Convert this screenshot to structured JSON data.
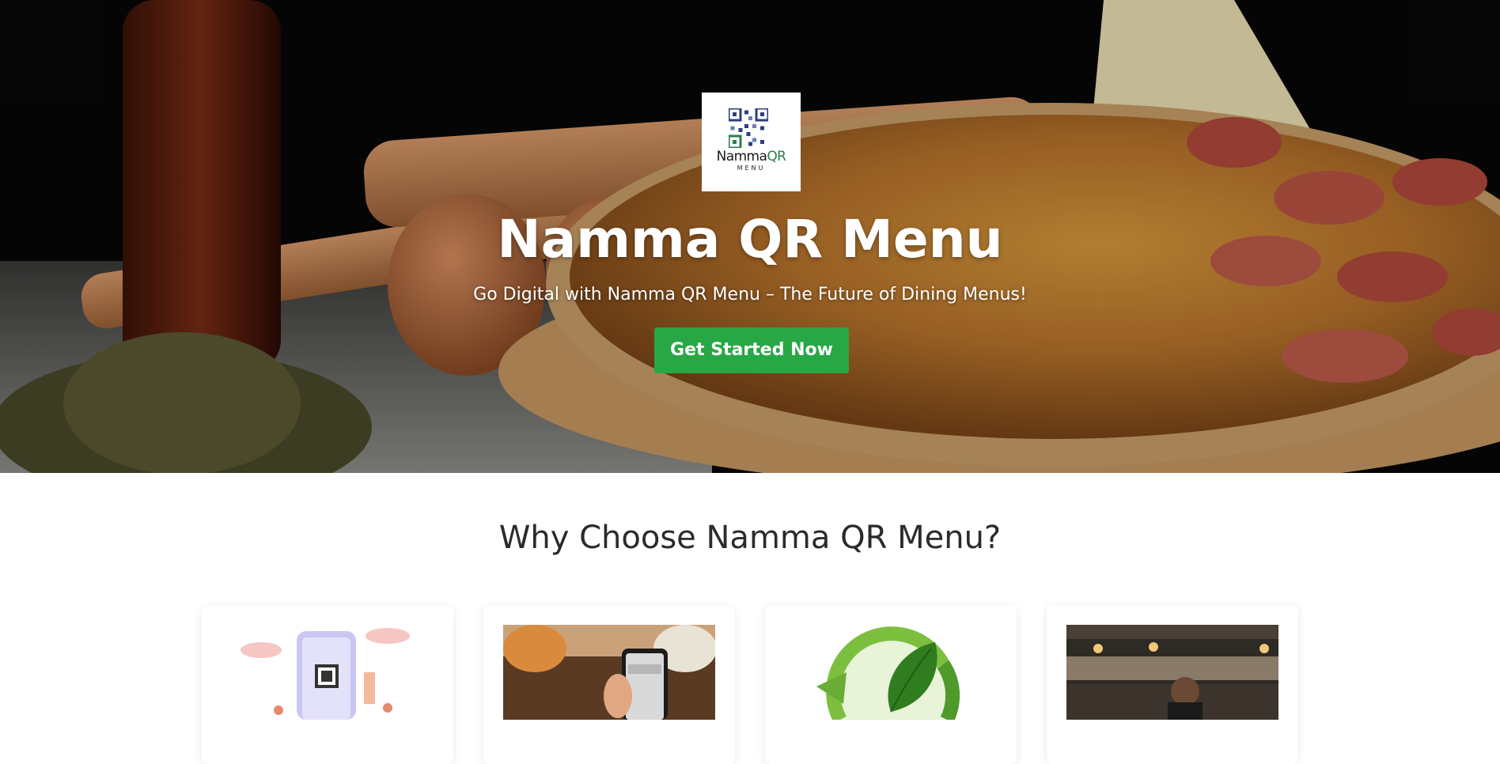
{
  "hero": {
    "logo": {
      "name_part1": "Namma",
      "name_part2": "QR",
      "sub": "MENU"
    },
    "title": "Namma QR Menu",
    "subtitle": "Go Digital with Namma QR Menu – The Future of Dining Menus!",
    "cta_label": "Get Started Now"
  },
  "why": {
    "title": "Why Choose Namma QR Menu?"
  },
  "colors": {
    "accent_green": "#28a745",
    "logo_green": "#2e7d4f"
  }
}
